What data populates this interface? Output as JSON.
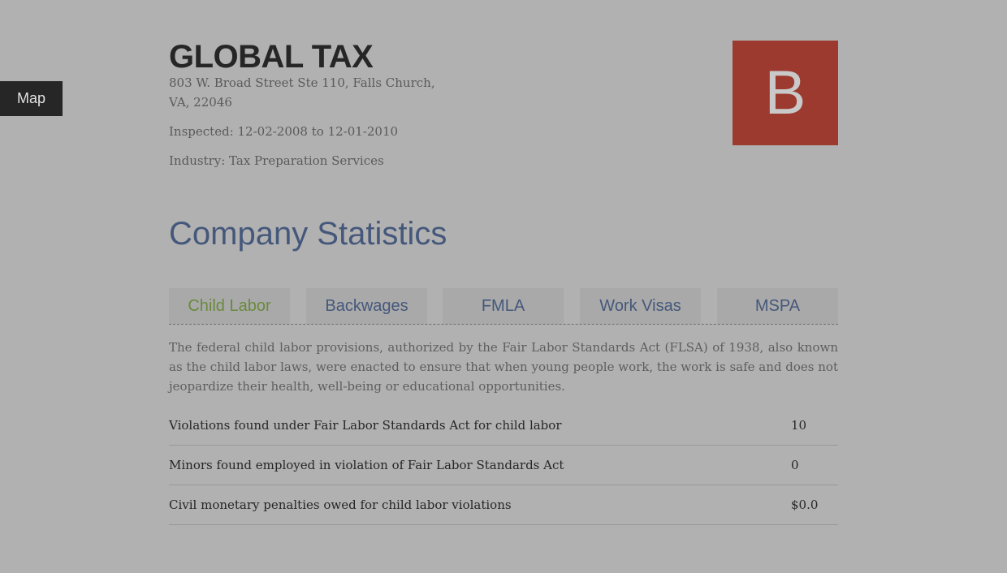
{
  "map_button": {
    "label": "Map"
  },
  "company": {
    "name": "GLOBAL TAX",
    "address": "803 W. Broad Street Ste 110, Falls Church, VA, 22046",
    "inspected": "Inspected: 12-02-2008 to 12-01-2010",
    "industry": "Industry: Tax Preparation Services",
    "grade": "B",
    "grade_color": "#9c3a2f"
  },
  "section": {
    "title": "Company Statistics"
  },
  "tabs": [
    {
      "label": "Child Labor",
      "active": true
    },
    {
      "label": "Backwages",
      "active": false
    },
    {
      "label": "FMLA",
      "active": false
    },
    {
      "label": "Work Visas",
      "active": false
    },
    {
      "label": "MSPA",
      "active": false
    }
  ],
  "description": "The federal child labor provisions, authorized by the Fair Labor Standards Act (FLSA) of 1938, also known as the child labor laws, were enacted to ensure that when young people work, the work is safe and does not jeopardize their health, well-being or educational opportunities.",
  "stats": [
    {
      "label": "Violations found under Fair Labor Standards Act for child labor",
      "value": "10"
    },
    {
      "label": "Minors found employed in violation of Fair Labor Standards Act",
      "value": "0"
    },
    {
      "label": "Civil monetary penalties owed for child labor violations",
      "value": "$0.0"
    }
  ],
  "colors": {
    "background": "#b1b1b1",
    "accent_blue": "#45587b",
    "active_tab_green": "#6a8a3c"
  }
}
